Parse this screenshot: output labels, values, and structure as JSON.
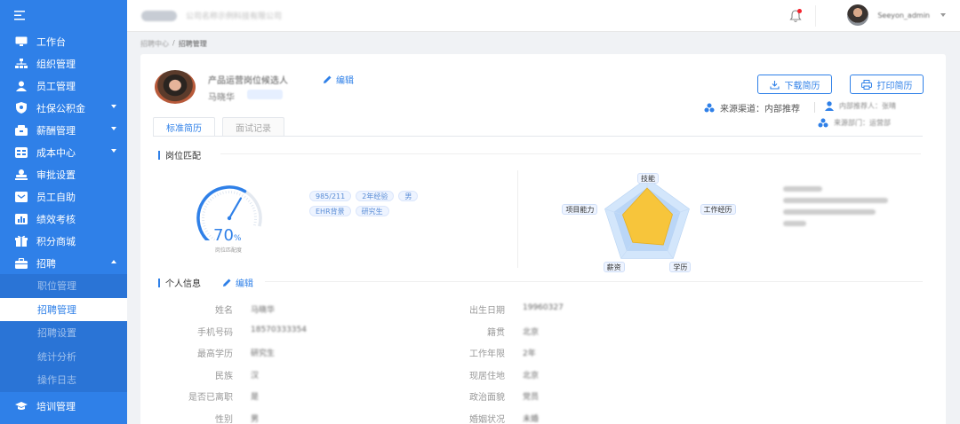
{
  "sidebar": {
    "items": [
      {
        "label": "工作台",
        "icon": "monitor-icon"
      },
      {
        "label": "组织管理",
        "icon": "org-icon"
      },
      {
        "label": "员工管理",
        "icon": "user-icon"
      },
      {
        "label": "社保公积金",
        "icon": "shield-icon",
        "caret": "down"
      },
      {
        "label": "薪酬管理",
        "icon": "wallet-icon",
        "caret": "down"
      },
      {
        "label": "成本中心",
        "icon": "card-icon",
        "caret": "down"
      },
      {
        "label": "审批设置",
        "icon": "stamp-icon"
      },
      {
        "label": "员工自助",
        "icon": "self-service-icon"
      },
      {
        "label": "绩效考核",
        "icon": "chart-icon"
      },
      {
        "label": "积分商城",
        "icon": "gift-icon"
      },
      {
        "label": "招聘",
        "icon": "briefcase-icon",
        "caret": "up"
      }
    ],
    "sub_items": [
      "职位管理",
      "招聘管理",
      "招聘设置",
      "统计分析",
      "操作日志"
    ],
    "last_item": {
      "label": "培训管理",
      "icon": "graduation-cap-icon"
    }
  },
  "header": {
    "company_name": "公司名称示例科技有限公司",
    "username": "Seeyon_admin"
  },
  "breadcrumb": {
    "prev": "招聘中心",
    "sep": "/",
    "current": "招聘管理"
  },
  "candidate": {
    "position_title": "产品运营岗位候选人",
    "edit_label": "编辑",
    "name": "马晓华",
    "download_label": "下载简历",
    "print_label": "打印简历",
    "source_label": "来源渠道：内部推荐",
    "referrer_text": "内部推荐人：张晴",
    "referrer2_text": "来源部门：运营部"
  },
  "tabs": [
    "标准简历",
    "面试记录"
  ],
  "match": {
    "section_title": "岗位匹配",
    "percent": "70",
    "percent_unit": "%",
    "gauge_label": "岗位匹配度",
    "gauge_value": 0.7,
    "tags": [
      "985/211",
      "2年经验",
      "男",
      "EHR背景",
      "研究生"
    ],
    "radar_labels": [
      "技能",
      "工作经历",
      "学历",
      "薪资",
      "项目能力"
    ],
    "radar_values": [
      0.78,
      0.6,
      0.62,
      0.55,
      0.58
    ]
  },
  "info": {
    "section_title": "个人信息",
    "edit_label": "编辑",
    "left": [
      {
        "label": "姓名",
        "value": "马晓华"
      },
      {
        "label": "手机号码",
        "value": "18570333354"
      },
      {
        "label": "最高学历",
        "value": "研究生"
      },
      {
        "label": "民族",
        "value": "汉"
      },
      {
        "label": "是否已离职",
        "value": "是"
      },
      {
        "label": "性别",
        "value": "男"
      }
    ],
    "right": [
      {
        "label": "出生日期",
        "value": "19960327"
      },
      {
        "label": "籍贯",
        "value": "北京"
      },
      {
        "label": "工作年限",
        "value": "2年"
      },
      {
        "label": "现居住地",
        "value": "北京"
      },
      {
        "label": "政治面貌",
        "value": "党员"
      },
      {
        "label": "婚姻状况",
        "value": "未婚"
      }
    ]
  },
  "colors": {
    "primary": "#2f80e8",
    "radar_fill": "#f7c53b"
  }
}
